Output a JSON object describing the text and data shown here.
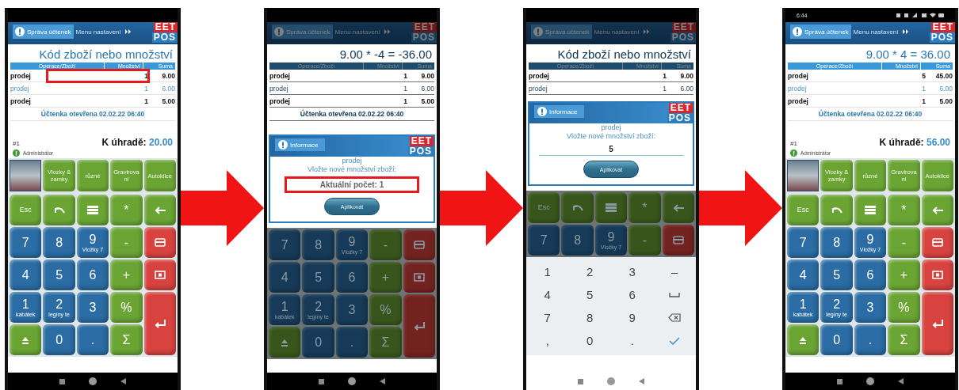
{
  "screens": [
    {
      "dimmed": false,
      "blocks": [
        {
          "kind": "status"
        },
        {
          "kind": "header",
          "tabs": [
            {
              "label": "Správa účtenek",
              "selected": true
            },
            {
              "label": "Menu nastavení",
              "selected": false
            }
          ],
          "logo": [
            "EET",
            "POS"
          ]
        },
        {
          "kind": "title",
          "text": "Kód zboží nebo množství"
        },
        {
          "kind": "table",
          "columns": [
            "Operace/Zboží",
            "Množství",
            "Suma"
          ],
          "rows": [
            {
              "item": "prodej",
              "qty": "1",
              "sum": "9.00",
              "selected": false,
              "highlighted": true
            },
            {
              "item": "prodej",
              "qty": "1",
              "sum": "6.00",
              "selected": true,
              "highlighted": false
            },
            {
              "item": "prodej",
              "qty": "1",
              "sum": "5.00",
              "selected": false,
              "highlighted": false
            }
          ]
        },
        {
          "kind": "receipt",
          "text": "Účtenka otevřena 02.02.22 06:40"
        },
        {
          "kind": "total",
          "number": "#1",
          "label": "K úhradě:",
          "amount": "20.00"
        },
        {
          "kind": "user",
          "name": "Administrátor"
        },
        {
          "kind": "categories",
          "items": [
            {
              "kind": "photo"
            },
            {
              "kind": "text",
              "label": "Vlozky & zamky"
            },
            {
              "kind": "text",
              "label": "různé"
            },
            {
              "kind": "text",
              "label": "Gravirova ni"
            },
            {
              "kind": "text",
              "label": "Autoklice"
            }
          ]
        },
        {
          "kind": "keypad",
          "keys": [
            {
              "kind": "text",
              "label": "Esc",
              "color": "#6aa534"
            },
            {
              "kind": "undo",
              "color": "#6aa534"
            },
            {
              "kind": "list",
              "color": "#6aa534"
            },
            {
              "kind": "text",
              "label": "*",
              "color": "#6aa534"
            },
            {
              "kind": "back",
              "color": "#6aa534"
            },
            {
              "kind": "text",
              "label": "7",
              "color": "#2a6ca3"
            },
            {
              "kind": "text",
              "label": "8",
              "color": "#2a6ca3"
            },
            {
              "kind": "text",
              "label": "9",
              "sub": "Vložky 7",
              "color": "#2a6ca3"
            },
            {
              "kind": "text",
              "label": "-",
              "color": "#6aa534"
            },
            {
              "kind": "card",
              "color": "#d8433f"
            },
            {
              "kind": "text",
              "label": "4",
              "color": "#2a6ca3"
            },
            {
              "kind": "text",
              "label": "5",
              "color": "#2a6ca3"
            },
            {
              "kind": "text",
              "label": "6",
              "color": "#2a6ca3"
            },
            {
              "kind": "text",
              "label": "+",
              "color": "#6aa534"
            },
            {
              "kind": "cash",
              "color": "#d8433f"
            },
            {
              "kind": "text",
              "label": "1",
              "sub": "kabátek",
              "color": "#2a6ca3"
            },
            {
              "kind": "text",
              "label": "2",
              "sub": "legíny te",
              "color": "#2a6ca3"
            },
            {
              "kind": "text",
              "label": "3",
              "color": "#2a6ca3"
            },
            {
              "kind": "text",
              "label": "%",
              "color": "#6aa534"
            },
            {
              "kind": "enter",
              "color": "#d8433f"
            },
            {
              "kind": "eject",
              "color": "#6aa534"
            },
            {
              "kind": "text",
              "label": "0",
              "color": "#2a6ca3"
            },
            {
              "kind": "text",
              "label": ".",
              "color": "#2a6ca3"
            },
            {
              "kind": "text",
              "label": "Σ",
              "color": "#6aa534"
            }
          ]
        },
        {
          "kind": "nav",
          "light": false
        }
      ]
    },
    {
      "dimmed": true,
      "blocks": [
        {
          "kind": "status"
        },
        {
          "kind": "header",
          "tabs": [
            {
              "label": "Správa účtenek",
              "selected": true
            },
            {
              "label": "Menu nastavení",
              "selected": false
            }
          ],
          "logo": [
            "EET",
            "POS"
          ]
        },
        {
          "kind": "title",
          "text": "9.00 * -4 = -36.00"
        },
        {
          "kind": "table",
          "columns": [
            "Operace/Zboží",
            "Množství",
            "Suma"
          ],
          "rows": [
            {
              "item": "prodej",
              "qty": "1",
              "sum": "9.00",
              "selected": false,
              "highlighted": false
            },
            {
              "item": "prodej",
              "qty": "1",
              "sum": "6.00",
              "selected": true,
              "highlighted": false
            },
            {
              "item": "prodej",
              "qty": "1",
              "sum": "5.00",
              "selected": false,
              "highlighted": false
            }
          ]
        },
        {
          "kind": "receipt",
          "text": "Účtenka otevřena 02.02.22 06:40"
        },
        {
          "kind": "dialog",
          "tab": "Informace",
          "logo": [
            "EET",
            "POS"
          ],
          "lines": [
            "prodej",
            "Vložte nové množství zboží:"
          ],
          "field": {
            "placeholder": "Aktuální počet: 1",
            "highlighted": true
          },
          "button": "Aplikovat"
        },
        {
          "kind": "keypad",
          "keys": [
            {
              "kind": "text",
              "label": "7",
              "color": "#163a57"
            },
            {
              "kind": "text",
              "label": "8",
              "color": "#163a57"
            },
            {
              "kind": "text",
              "label": "9",
              "sub": "Vložky 7",
              "color": "#163a57"
            },
            {
              "kind": "text",
              "label": "-",
              "color": "#38561c"
            },
            {
              "kind": "card",
              "color": "#722320"
            },
            {
              "kind": "text",
              "label": "4",
              "color": "#163a57"
            },
            {
              "kind": "text",
              "label": "5",
              "color": "#163a57"
            },
            {
              "kind": "text",
              "label": "6",
              "color": "#163a57"
            },
            {
              "kind": "text",
              "label": "+",
              "color": "#38561c"
            },
            {
              "kind": "cash",
              "color": "#722320"
            },
            {
              "kind": "text",
              "label": "1",
              "sub": "kabátek",
              "color": "#163a57"
            },
            {
              "kind": "text",
              "label": "2",
              "sub": "legíny te",
              "color": "#163a57"
            },
            {
              "kind": "text",
              "label": "3",
              "color": "#163a57"
            },
            {
              "kind": "text",
              "label": "%",
              "color": "#38561c"
            },
            {
              "kind": "enter",
              "color": "#722320"
            },
            {
              "kind": "eject",
              "color": "#38561c"
            },
            {
              "kind": "text",
              "label": "0",
              "color": "#163a57"
            },
            {
              "kind": "text",
              "label": ".",
              "color": "#163a57"
            },
            {
              "kind": "text",
              "label": "Σ",
              "color": "#38561c"
            }
          ]
        },
        {
          "kind": "nav",
          "light": false
        }
      ]
    },
    {
      "dimmed": true,
      "blocks": [
        {
          "kind": "status"
        },
        {
          "kind": "header",
          "tabs": [
            {
              "label": "Správa účtenek",
              "selected": true
            },
            {
              "label": "Menu nastavení",
              "selected": false
            }
          ],
          "logo": [
            "EET",
            "POS"
          ]
        },
        {
          "kind": "title",
          "text": "Kód zboží nebo množství"
        },
        {
          "kind": "table",
          "columns": [
            "Operace/Zboží",
            "Množství",
            "Suma"
          ],
          "rows": [
            {
              "item": "prodej",
              "qty": "1",
              "sum": "9.00",
              "selected": false,
              "highlighted": false
            },
            {
              "item": "prodej",
              "qty": "1",
              "sum": "6.00",
              "selected": true,
              "highlighted": false
            }
          ]
        },
        {
          "kind": "dialog",
          "tab": "Informace",
          "logo": [
            "EET",
            "POS"
          ],
          "lines": [
            "prodej",
            "Vložte nové množství zboží:"
          ],
          "field": {
            "value": "5",
            "highlighted": false
          },
          "button": "Aplikovat"
        },
        {
          "kind": "keypad",
          "keys": [
            {
              "kind": "text",
              "label": "Esc",
              "color": "#38561c"
            },
            {
              "kind": "undo",
              "color": "#38561c"
            },
            {
              "kind": "list",
              "color": "#38561c"
            },
            {
              "kind": "text",
              "label": "*",
              "color": "#38561c"
            },
            {
              "kind": "back",
              "color": "#38561c"
            },
            {
              "kind": "text",
              "label": "7",
              "color": "#163a57"
            },
            {
              "kind": "text",
              "label": "8",
              "color": "#163a57"
            },
            {
              "kind": "text",
              "label": "9",
              "sub": "Vložky 7",
              "color": "#163a57"
            },
            {
              "kind": "text",
              "label": "-",
              "color": "#38561c"
            },
            {
              "kind": "card",
              "color": "#722320"
            }
          ]
        },
        {
          "kind": "softkeys",
          "keys": [
            {
              "kind": "text",
              "label": "1"
            },
            {
              "kind": "text",
              "label": "2"
            },
            {
              "kind": "text",
              "label": "3"
            },
            {
              "kind": "text",
              "label": "–"
            },
            {
              "kind": "text",
              "label": "4"
            },
            {
              "kind": "text",
              "label": "5"
            },
            {
              "kind": "text",
              "label": "6"
            },
            {
              "kind": "space"
            },
            {
              "kind": "text",
              "label": "7"
            },
            {
              "kind": "text",
              "label": "8"
            },
            {
              "kind": "text",
              "label": "9"
            },
            {
              "kind": "delete"
            },
            {
              "kind": "text",
              "label": ","
            },
            {
              "kind": "text",
              "label": "0"
            },
            {
              "kind": "text",
              "label": "."
            },
            {
              "kind": "check"
            }
          ]
        },
        {
          "kind": "nav",
          "light": true
        }
      ]
    },
    {
      "dimmed": false,
      "blocks": [
        {
          "kind": "status",
          "time": "6:44"
        },
        {
          "kind": "header",
          "tabs": [
            {
              "label": "Správa účtenek",
              "selected": true
            },
            {
              "label": "Menu nastavení",
              "selected": false
            }
          ],
          "logo": [
            "EET",
            "POS"
          ]
        },
        {
          "kind": "title",
          "text": "9.00 * 4 = 36.00"
        },
        {
          "kind": "table",
          "columns": [
            "Operace/Zboží",
            "Množství",
            "Suma"
          ],
          "rows": [
            {
              "item": "prodej",
              "qty": "5",
              "sum": "45.00",
              "selected": false,
              "highlighted": false
            },
            {
              "item": "prodej",
              "qty": "1",
              "sum": "6.00",
              "selected": true,
              "highlighted": false
            },
            {
              "item": "prodej",
              "qty": "1",
              "sum": "5.00",
              "selected": false,
              "highlighted": false
            }
          ]
        },
        {
          "kind": "receipt",
          "text": "Účtenka otevřena 02.02.22 06:40"
        },
        {
          "kind": "total",
          "number": "#1",
          "label": "K úhradě:",
          "amount": "56.00"
        },
        {
          "kind": "user",
          "name": "Administrátor"
        },
        {
          "kind": "categories",
          "items": [
            {
              "kind": "photo"
            },
            {
              "kind": "text",
              "label": "Vlozky & zamky"
            },
            {
              "kind": "text",
              "label": "různé"
            },
            {
              "kind": "text",
              "label": "Gravirova ni"
            },
            {
              "kind": "text",
              "label": "Autoklice"
            }
          ]
        },
        {
          "kind": "keypad",
          "keys": [
            {
              "kind": "text",
              "label": "Esc",
              "color": "#6aa534"
            },
            {
              "kind": "undo",
              "color": "#6aa534"
            },
            {
              "kind": "list",
              "color": "#6aa534"
            },
            {
              "kind": "text",
              "label": "*",
              "color": "#6aa534"
            },
            {
              "kind": "back",
              "color": "#6aa534"
            },
            {
              "kind": "text",
              "label": "7",
              "color": "#2a6ca3"
            },
            {
              "kind": "text",
              "label": "8",
              "color": "#2a6ca3"
            },
            {
              "kind": "text",
              "label": "9",
              "sub": "Vložky 7",
              "color": "#2a6ca3"
            },
            {
              "kind": "text",
              "label": "-",
              "color": "#6aa534"
            },
            {
              "kind": "card",
              "color": "#d8433f"
            },
            {
              "kind": "text",
              "label": "4",
              "color": "#2a6ca3"
            },
            {
              "kind": "text",
              "label": "5",
              "color": "#2a6ca3"
            },
            {
              "kind": "text",
              "label": "6",
              "color": "#2a6ca3"
            },
            {
              "kind": "text",
              "label": "+",
              "color": "#6aa534"
            },
            {
              "kind": "cash",
              "color": "#d8433f"
            },
            {
              "kind": "text",
              "label": "1",
              "sub": "kabátek",
              "color": "#2a6ca3"
            },
            {
              "kind": "text",
              "label": "2",
              "sub": "legíny te",
              "color": "#2a6ca3"
            },
            {
              "kind": "text",
              "label": "3",
              "color": "#2a6ca3"
            },
            {
              "kind": "text",
              "label": "%",
              "color": "#6aa534"
            },
            {
              "kind": "enter",
              "color": "#d8433f"
            },
            {
              "kind": "eject",
              "color": "#6aa534"
            },
            {
              "kind": "text",
              "label": "0",
              "color": "#2a6ca3"
            },
            {
              "kind": "text",
              "label": ".",
              "color": "#2a6ca3"
            },
            {
              "kind": "text",
              "label": "Σ",
              "color": "#6aa534"
            }
          ]
        },
        {
          "kind": "nav",
          "light": false
        }
      ]
    }
  ]
}
